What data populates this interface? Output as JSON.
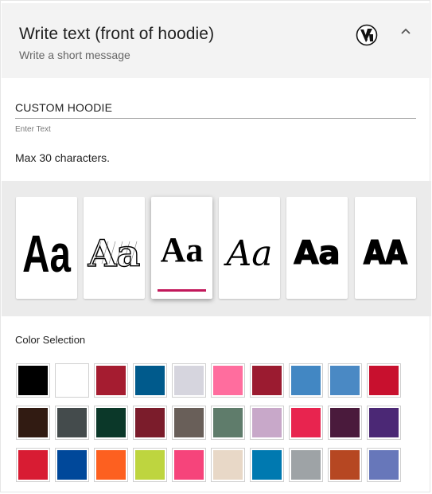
{
  "header": {
    "title": "Write text (front of hoodie)",
    "subtitle": "Write a short message",
    "logo_icon": "brand-logo-icon",
    "collapse_icon": "chevron-up-icon"
  },
  "text_input": {
    "value": "CUSTOM HOODIE",
    "label": "Enter Text"
  },
  "hint": "Max 30 characters.",
  "font_options": [
    {
      "sample": "Aa",
      "style": "condensed-bold",
      "selected": false
    },
    {
      "sample": "Aa",
      "style": "sketch-outline",
      "selected": false
    },
    {
      "sample": "Aa",
      "style": "serif-bold",
      "selected": true
    },
    {
      "sample": "Aa",
      "style": "script",
      "selected": false
    },
    {
      "sample": "Aa",
      "style": "heavy-sans",
      "selected": false
    },
    {
      "sample": "AA",
      "style": "rounded-heavy",
      "selected": false
    }
  ],
  "colors": {
    "label": "Color Selection",
    "selected_underline": "#c2185b",
    "swatches": [
      "#000000",
      "#ffffff",
      "#a51c30",
      "#005a8c",
      "#d6d5de",
      "#ff6d9e",
      "#9b1b30",
      "#4287c3",
      "#4a89c4",
      "#c8102e",
      "#311b12",
      "#444b4c",
      "#0b3829",
      "#7b1c2b",
      "#695f59",
      "#5f7c6b",
      "#c8a8c9",
      "#e8244f",
      "#4a1a3c",
      "#4b2875",
      "#d81c33",
      "#00489a",
      "#fd6020",
      "#bed53f",
      "#f6447b",
      "#e8d8c7",
      "#0079b0",
      "#9ea3a6",
      "#b64722",
      "#6777ba"
    ]
  }
}
